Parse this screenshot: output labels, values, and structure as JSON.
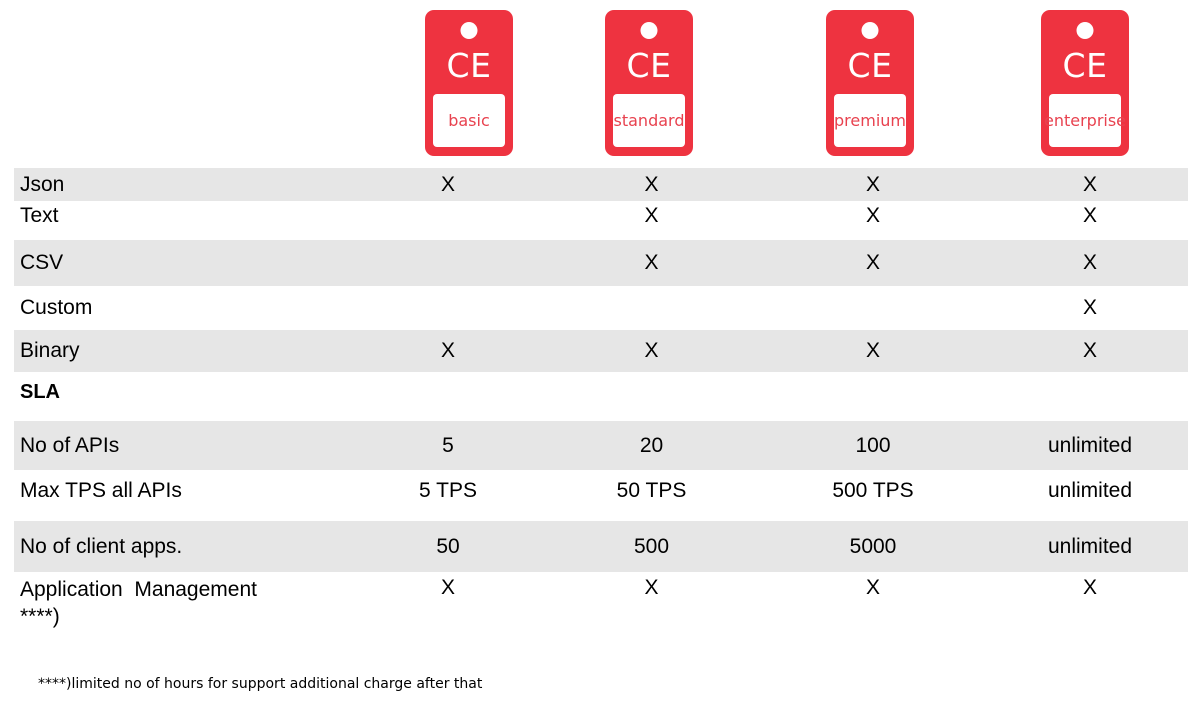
{
  "plans": [
    {
      "brand": "CE",
      "name": "basic"
    },
    {
      "brand": "CE",
      "name": "standard"
    },
    {
      "brand": "CE",
      "name": "premium"
    },
    {
      "brand": "CE",
      "name": "enterprise"
    }
  ],
  "colors": {
    "tag_red": "#ee3340",
    "tag_label_red": "#e8424f",
    "row_band_gray": "#e6e6e6",
    "page_background": "#ffffff",
    "text": "#000000"
  },
  "table": {
    "columns": [
      "",
      "basic",
      "standard",
      "premium",
      "enterprise"
    ],
    "rows": [
      {
        "label": "Json",
        "shaded": true,
        "values": [
          "X",
          "X",
          "X",
          "X"
        ]
      },
      {
        "label": "Text",
        "shaded": false,
        "values": [
          "",
          "X",
          "X",
          "X"
        ]
      },
      {
        "label": "CSV",
        "shaded": true,
        "values": [
          "",
          "X",
          "X",
          "X"
        ]
      },
      {
        "label": "Custom",
        "shaded": false,
        "values": [
          "",
          "",
          "",
          "X"
        ]
      },
      {
        "label": "Binary",
        "shaded": true,
        "values": [
          "X",
          "X",
          "X",
          "X"
        ]
      },
      {
        "label": "SLA",
        "shaded": false,
        "values": [
          "",
          "",
          "",
          ""
        ],
        "header": true
      },
      {
        "label": "No of APIs",
        "shaded": true,
        "values": [
          "5",
          "20",
          "100",
          "unlimited"
        ]
      },
      {
        "label": "Max TPS all APIs",
        "shaded": false,
        "values": [
          "5 TPS",
          "50 TPS",
          "500 TPS",
          "unlimited"
        ]
      },
      {
        "label": "No of client apps.",
        "shaded": true,
        "values": [
          "50",
          "500",
          "5000",
          "unlimited"
        ]
      },
      {
        "label": "Application  Management\n****)",
        "shaded": false,
        "values": [
          "X",
          "X",
          "X",
          "X"
        ]
      }
    ]
  },
  "footnote": {
    "text": "****)limited no of hours for support additional charge after that"
  }
}
